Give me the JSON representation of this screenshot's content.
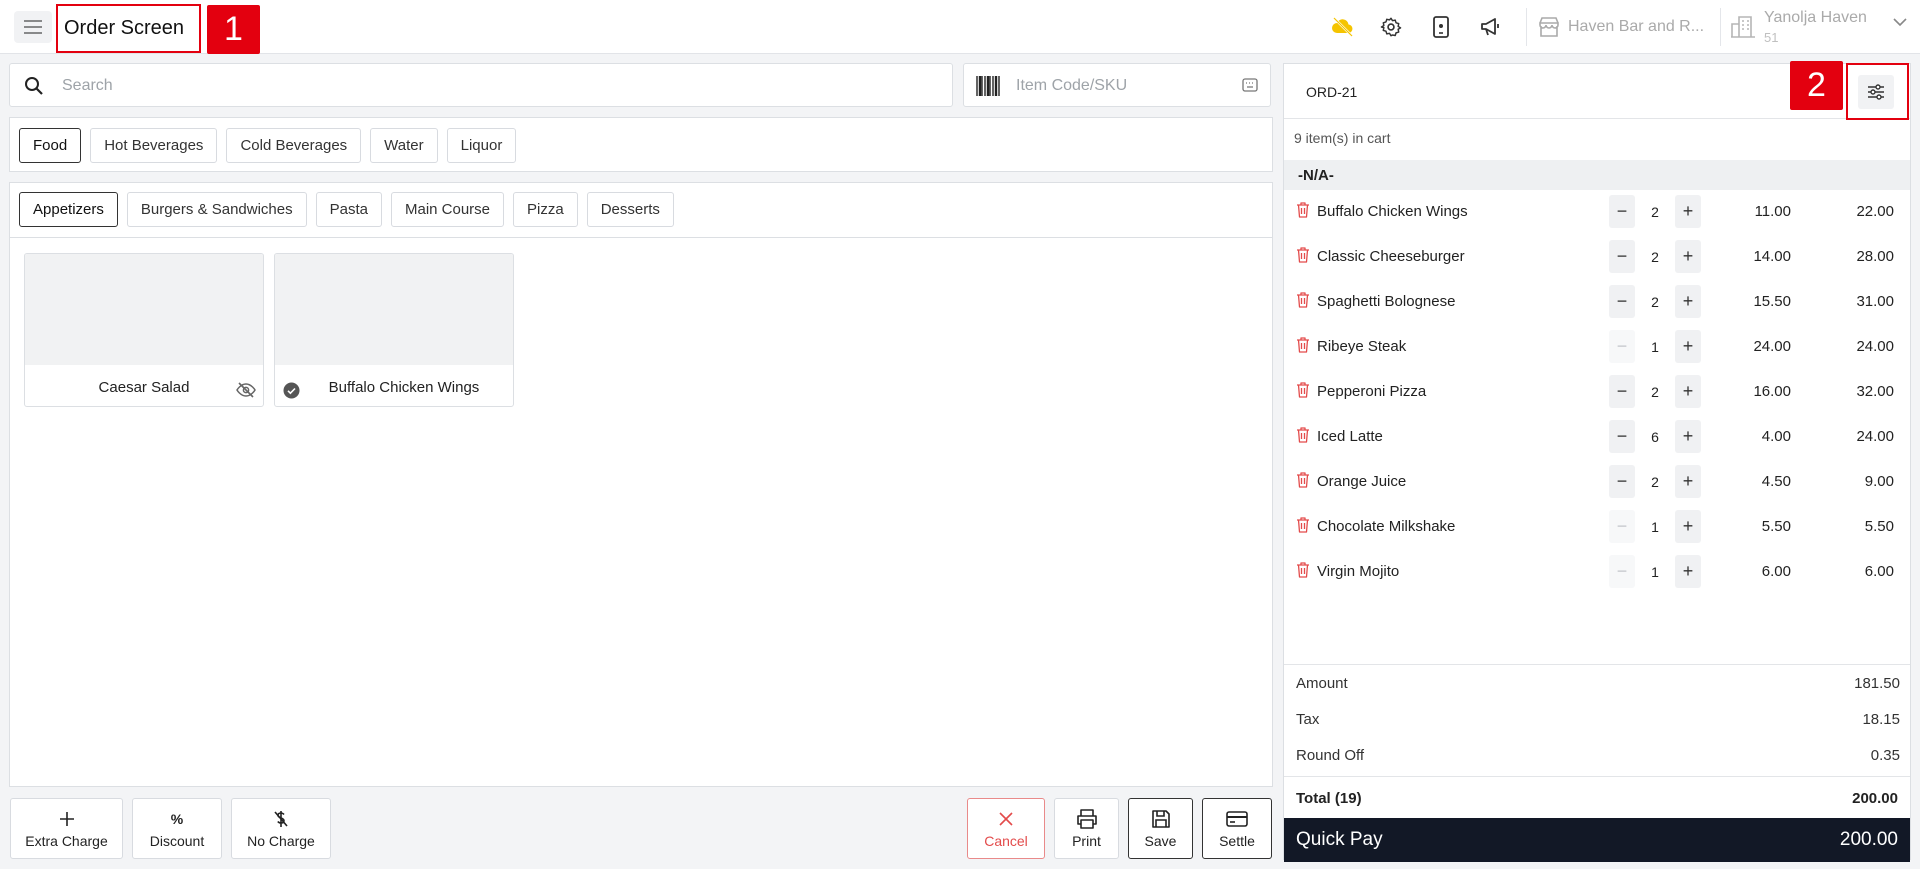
{
  "header": {
    "title": "Order Screen",
    "annotation_1": "1",
    "annotation_2": "2",
    "store_name": "Haven Bar and R...",
    "profile_name": "Yanolja Haven",
    "profile_number": "51"
  },
  "search": {
    "placeholder": "Search"
  },
  "sku": {
    "placeholder": "Item Code/SKU"
  },
  "categories": [
    {
      "label": "Food",
      "active": true
    },
    {
      "label": "Hot Beverages",
      "active": false
    },
    {
      "label": "Cold Beverages",
      "active": false
    },
    {
      "label": "Water",
      "active": false
    },
    {
      "label": "Liquor",
      "active": false
    }
  ],
  "subcategories": [
    {
      "label": "Appetizers",
      "active": true
    },
    {
      "label": "Burgers & Sandwiches",
      "active": false
    },
    {
      "label": "Pasta",
      "active": false
    },
    {
      "label": "Main Course",
      "active": false
    },
    {
      "label": "Pizza",
      "active": false
    },
    {
      "label": "Desserts",
      "active": false
    }
  ],
  "items": [
    {
      "name": "Caesar Salad",
      "icon": "eye-off-icon"
    },
    {
      "name": "Buffalo Chicken Wings",
      "icon": "check-circle-icon"
    }
  ],
  "actions": {
    "extra_charge": "Extra Charge",
    "discount": "Discount",
    "no_charge": "No Charge",
    "cancel": "Cancel",
    "print": "Print",
    "save": "Save",
    "settle": "Settle"
  },
  "cart": {
    "order_id": "ORD-21",
    "count_text": "9 item(s) in cart",
    "group": "-N/A-",
    "lines": [
      {
        "name": "Buffalo Chicken Wings",
        "qty": "2",
        "price": "11.00",
        "total": "22.00",
        "minus_disabled": false
      },
      {
        "name": "Classic Cheeseburger",
        "qty": "2",
        "price": "14.00",
        "total": "28.00",
        "minus_disabled": false
      },
      {
        "name": "Spaghetti Bolognese",
        "qty": "2",
        "price": "15.50",
        "total": "31.00",
        "minus_disabled": false
      },
      {
        "name": "Ribeye Steak",
        "qty": "1",
        "price": "24.00",
        "total": "24.00",
        "minus_disabled": true
      },
      {
        "name": "Pepperoni Pizza",
        "qty": "2",
        "price": "16.00",
        "total": "32.00",
        "minus_disabled": false
      },
      {
        "name": "Iced Latte",
        "qty": "6",
        "price": "4.00",
        "total": "24.00",
        "minus_disabled": false
      },
      {
        "name": "Orange Juice",
        "qty": "2",
        "price": "4.50",
        "total": "9.00",
        "minus_disabled": false
      },
      {
        "name": "Chocolate Milkshake",
        "qty": "1",
        "price": "5.50",
        "total": "5.50",
        "minus_disabled": true
      },
      {
        "name": "Virgin Mojito",
        "qty": "1",
        "price": "6.00",
        "total": "6.00",
        "minus_disabled": true
      }
    ],
    "summary": {
      "amount_label": "Amount",
      "amount": "181.50",
      "tax_label": "Tax",
      "tax": "18.15",
      "round_label": "Round Off",
      "round": "0.35",
      "total_label": "Total (19)",
      "total": "200.00"
    },
    "quickpay_label": "Quick Pay",
    "quickpay_amount": "200.00"
  },
  "colors": {
    "accent_red": "#e3000f",
    "dark": "#121826",
    "warning_yellow": "#f5c400",
    "delete_red": "#e34b4b"
  }
}
